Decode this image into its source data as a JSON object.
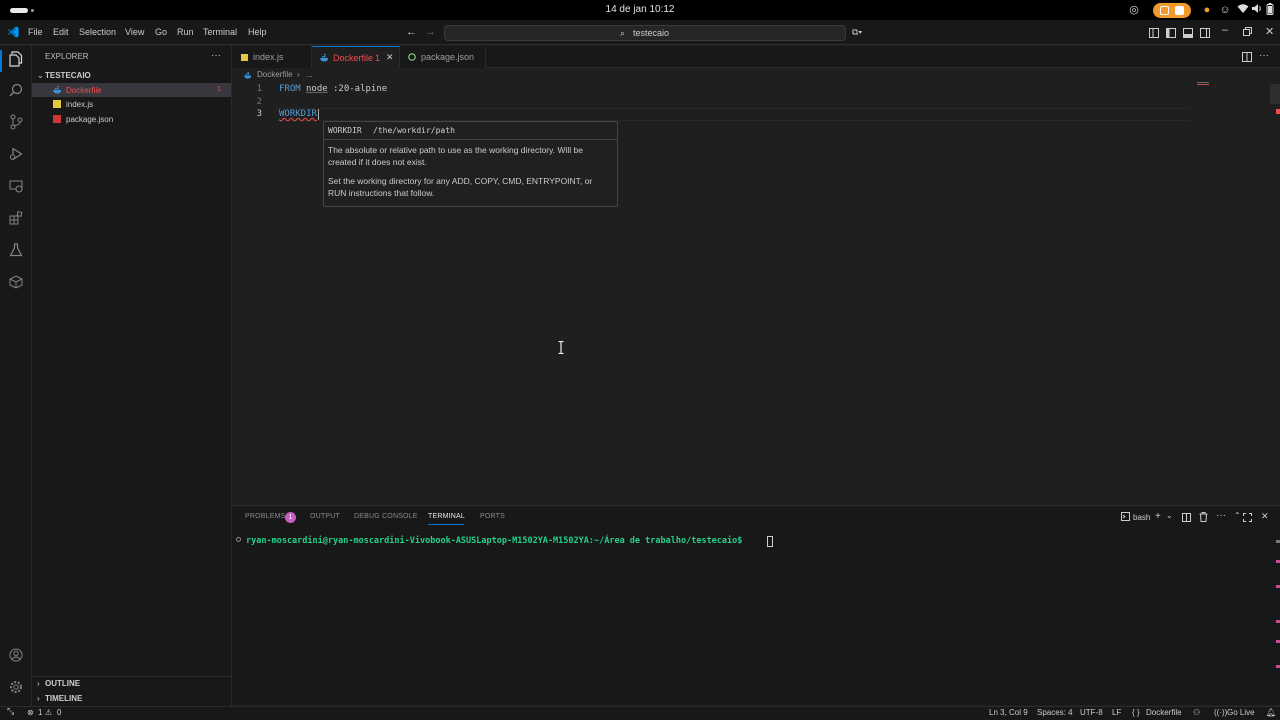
{
  "os": {
    "clock": "14 de jan  10:12"
  },
  "menu": [
    "File",
    "Edit",
    "Selection",
    "View",
    "Go",
    "Run",
    "Terminal",
    "Help"
  ],
  "command_center": {
    "text": "testecaio"
  },
  "explorer": {
    "title": "EXPLORER",
    "folder": "TESTECAIO",
    "files": [
      {
        "name": "Dockerfile",
        "badge": "1",
        "icon": "docker-icon"
      },
      {
        "name": "index.js",
        "icon": "js-icon"
      },
      {
        "name": "package.json",
        "icon": "npm-icon"
      }
    ],
    "outline": "OUTLINE",
    "timeline": "TIMELINE"
  },
  "tabs": [
    {
      "label": "index.js"
    },
    {
      "label": "Dockerfile",
      "badge": "1"
    },
    {
      "label": "package.json"
    }
  ],
  "breadcrumb": {
    "file": "Dockerfile",
    "rest": "..."
  },
  "editor": {
    "lines": [
      {
        "num": "1",
        "kw": "FROM",
        "image": "node",
        "rest": ":20-alpine"
      },
      {
        "num": "2"
      },
      {
        "num": "3",
        "kw": "WORKDIR"
      }
    ]
  },
  "hover": {
    "signature_kw": "WORKDIR",
    "signature_arg": "/the/workdir/path",
    "desc1": "The absolute or relative path to use as the working directory. Will be created if it does not exist.",
    "desc2": "Set the working directory for any ADD, COPY, CMD, ENTRYPOINT, or RUN instructions that follow."
  },
  "panel": {
    "tabs": [
      "PROBLEMS",
      "OUTPUT",
      "DEBUG CONSOLE",
      "TERMINAL",
      "PORTS"
    ],
    "problems_count": "1",
    "shell": "bash",
    "prompt": "ryan-moscardini@ryan-moscardini-Vivobook-ASUSLaptop-M1502YA-M1502YA:~/Área de trabalho/testecaio$"
  },
  "status": {
    "errors": "1",
    "warnings": "0",
    "position": "Ln 3, Col 9",
    "spaces": "Spaces: 4",
    "encoding": "UTF-8",
    "eol": "LF",
    "language": "Dockerfile",
    "golive": "Go Live"
  },
  "colors": {
    "accent": "#0078d4",
    "keyword": "#569cd6",
    "error": "#f14c4c",
    "docker": "#3d8fd6",
    "tray_orange": "#f29b2c",
    "terminal_green": "#23d18b"
  }
}
